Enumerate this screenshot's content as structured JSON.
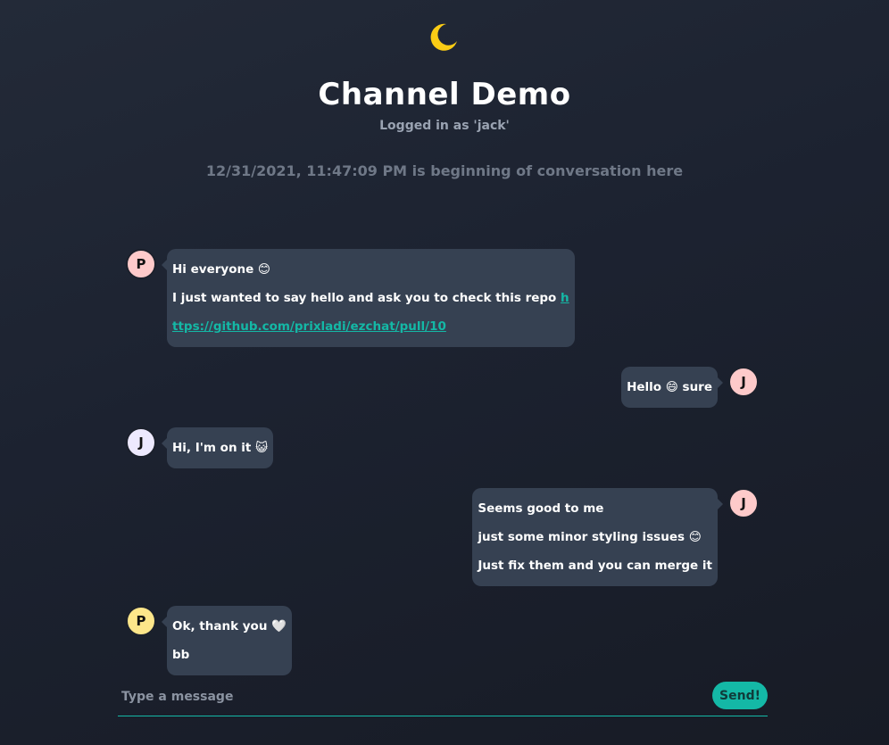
{
  "header": {
    "logo_icon": "moon-icon",
    "logo_color": "#facc15",
    "title": "Channel Demo",
    "subtitle": "Logged in as 'jack'"
  },
  "conversation_start": "12/31/2021, 11:47:09 PM is beginning of conversation here",
  "messages": [
    {
      "side": "left",
      "avatar": {
        "initial": "P",
        "color": "#fecaca"
      },
      "lines": [
        "Hi everyone 😊",
        "I just wanted to say hello and ask you to check this repo "
      ],
      "link_part1": "h",
      "link_part2": "ttps://github.com/prixladi/ezchat/pull/10"
    },
    {
      "side": "right",
      "avatar": {
        "initial": "J",
        "color": "#fecaca"
      },
      "lines": [
        "Hello 😄 sure"
      ]
    },
    {
      "side": "left",
      "avatar": {
        "initial": "J",
        "color": "#ede9fe"
      },
      "lines": [
        "Hi, I'm on it 😺"
      ]
    },
    {
      "side": "right",
      "avatar": {
        "initial": "J",
        "color": "#fecaca"
      },
      "lines": [
        "Seems good to me",
        "just some minor styling issues 😊",
        "Just fix them and you can merge it"
      ]
    },
    {
      "side": "left",
      "avatar": {
        "initial": "P",
        "color": "#fde68a"
      },
      "lines": [
        "Ok, thank you 🤍",
        "bb"
      ]
    }
  ],
  "composer": {
    "placeholder": "Type a message",
    "value": "",
    "send_label": "Send!",
    "accent_color": "#14b8a6"
  },
  "colors": {
    "bubble": "#364152",
    "link": "#14b8a6"
  }
}
